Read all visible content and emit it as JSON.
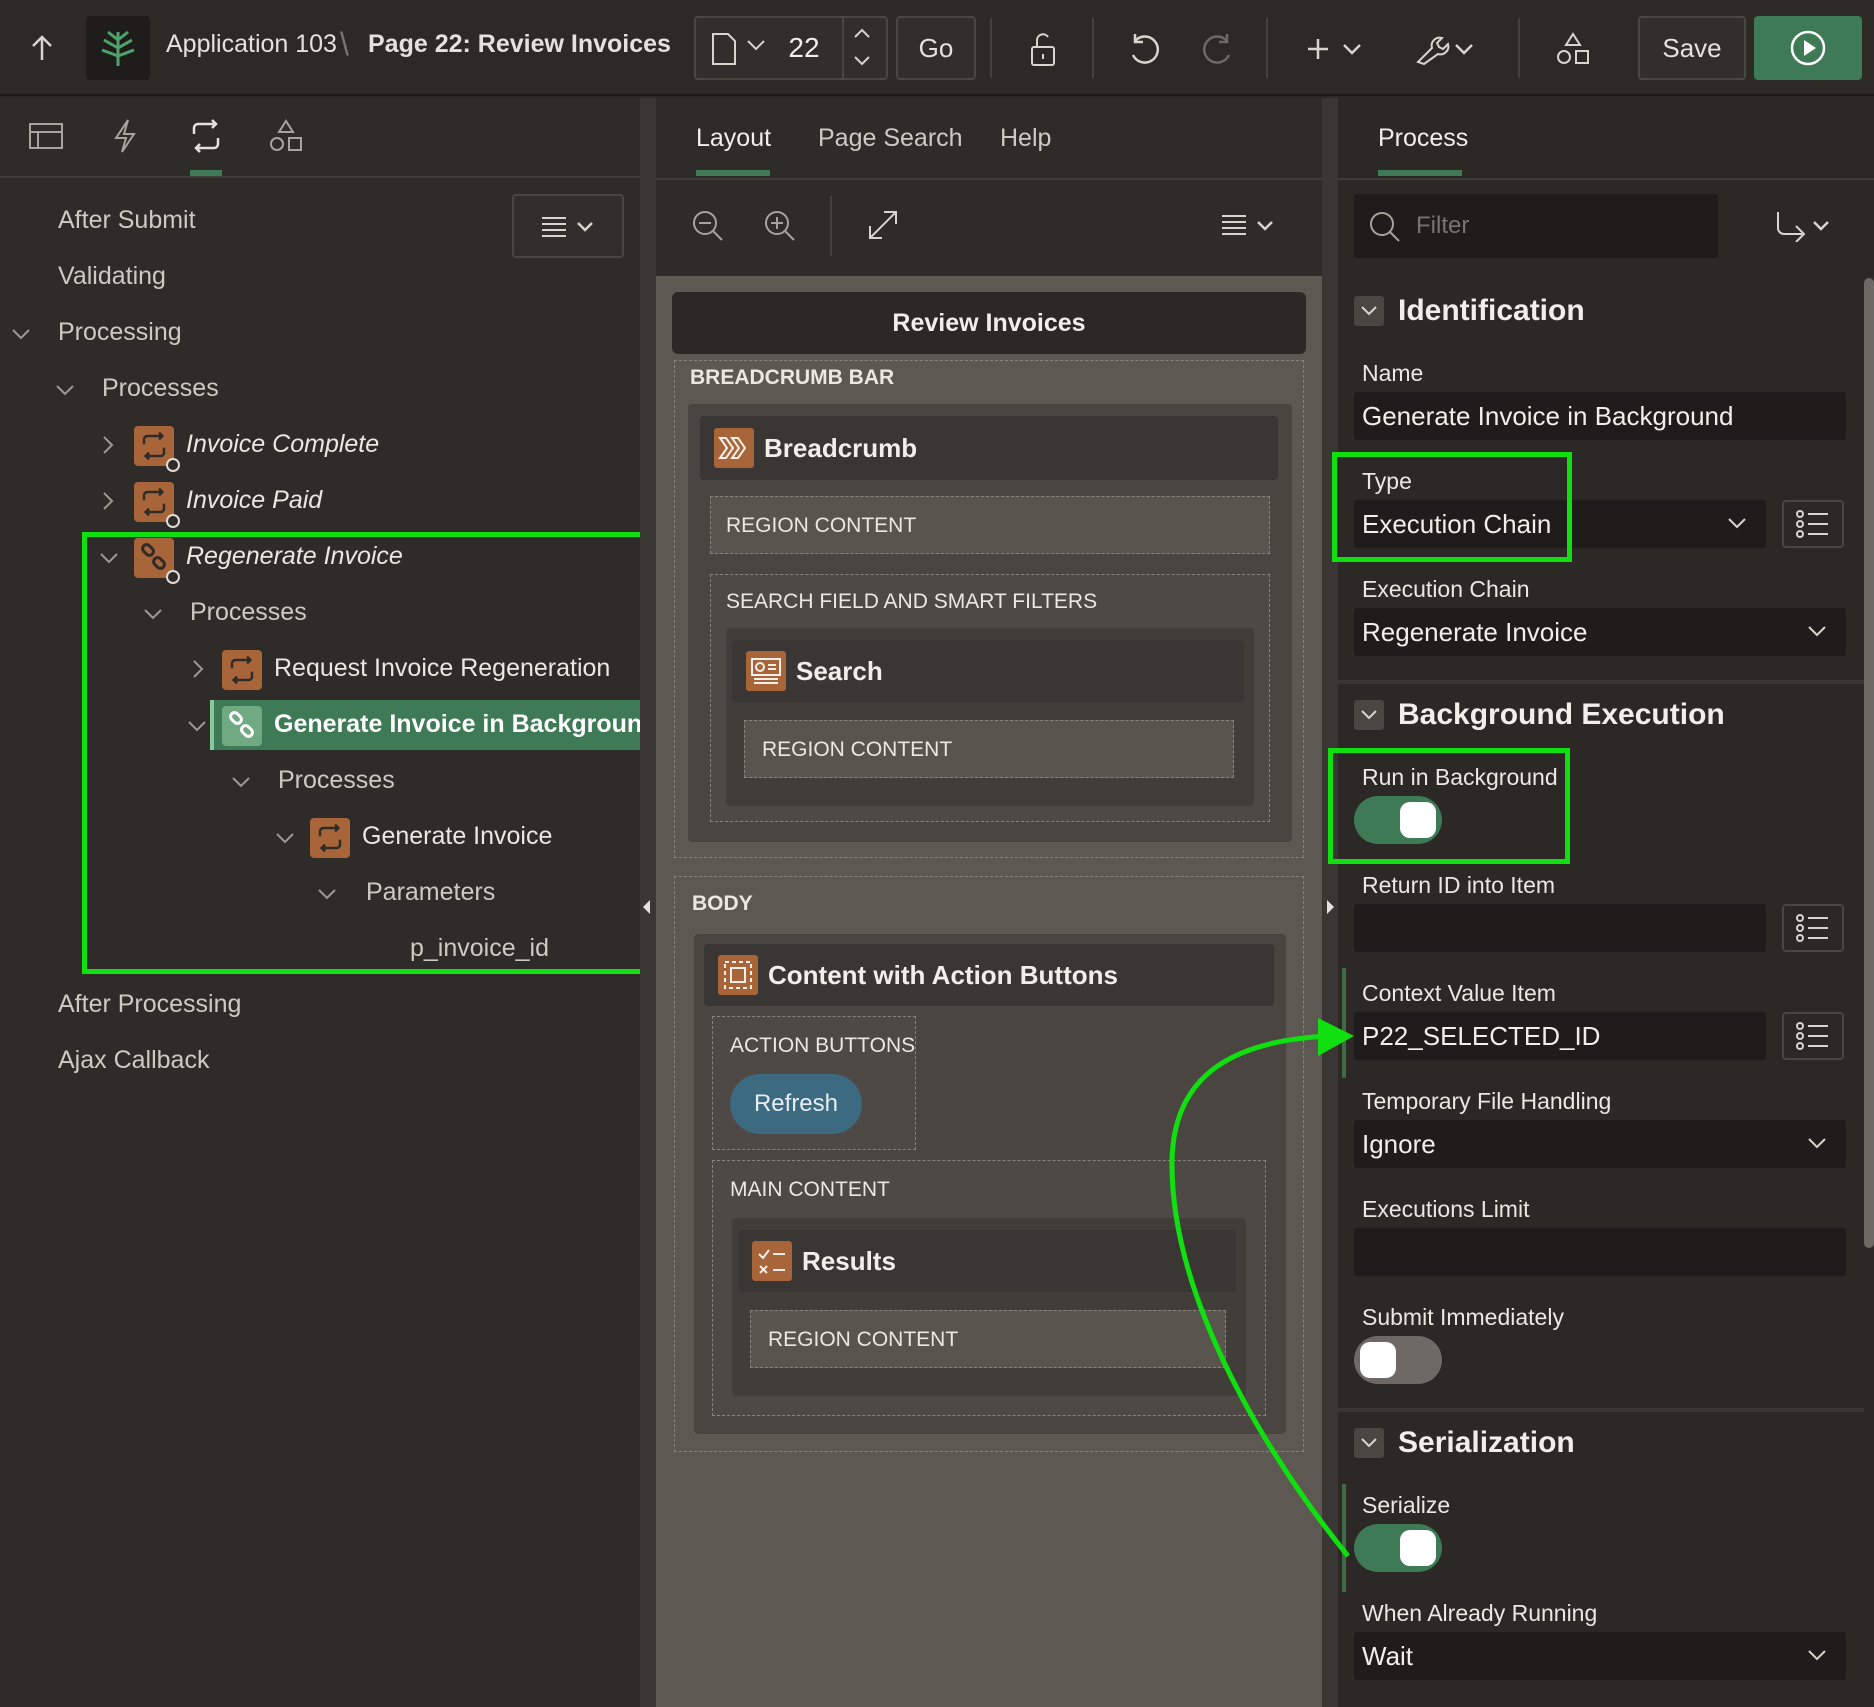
{
  "header": {
    "app_name": "Application 103",
    "separator": "\\",
    "page_title": "Page 22: Review Invoices",
    "page_number": "22",
    "go_label": "Go",
    "save_label": "Save"
  },
  "left_panel": {
    "tree": {
      "after_submit": "After Submit",
      "validating": "Validating",
      "processing": "Processing",
      "processes": "Processes",
      "invoice_complete": "Invoice Complete",
      "invoice_paid": "Invoice Paid",
      "regenerate_invoice": "Regenerate Invoice",
      "processes_2": "Processes",
      "request_regen": "Request Invoice Regeneration",
      "generate_bg": "Generate Invoice in Background",
      "processes_3": "Processes",
      "generate_invoice": "Generate Invoice",
      "parameters": "Parameters",
      "p_invoice_id": "p_invoice_id",
      "after_processing": "After Processing",
      "ajax_callback": "Ajax Callback"
    }
  },
  "center_panel": {
    "tabs": [
      "Layout",
      "Page Search",
      "Help"
    ],
    "page_name": "Review Invoices",
    "breadcrumb_bar": "BREADCRUMB BAR",
    "breadcrumb_region": "Breadcrumb",
    "region_content": "REGION CONTENT",
    "search_slot": "SEARCH FIELD AND SMART FILTERS",
    "search_region": "Search",
    "body_label": "BODY",
    "content_region": "Content with Action Buttons",
    "action_buttons": "ACTION BUTTONS",
    "refresh_label": "Refresh",
    "main_content": "MAIN CONTENT",
    "results_region": "Results"
  },
  "right_panel": {
    "tab": "Process",
    "filter_placeholder": "Filter",
    "identification": "Identification",
    "name_label": "Name",
    "name_value": "Generate Invoice in Background",
    "type_label": "Type",
    "type_value": "Execution Chain",
    "exec_chain_label": "Execution Chain",
    "exec_chain_value": "Regenerate Invoice",
    "background_execution": "Background Execution",
    "run_in_bg_label": "Run in Background",
    "run_in_bg_on": true,
    "return_id_label": "Return ID into Item",
    "return_id_value": "",
    "context_value_label": "Context Value Item",
    "context_value_value": "P22_SELECTED_ID",
    "temp_file_label": "Temporary File Handling",
    "temp_file_value": "Ignore",
    "exec_limit_label": "Executions Limit",
    "exec_limit_value": "",
    "submit_immediately_label": "Submit Immediately",
    "submit_immediately_on": false,
    "serialization": "Serialization",
    "serialize_label": "Serialize",
    "serialize_on": true,
    "when_running_label": "When Already Running",
    "when_running_value": "Wait"
  },
  "colors": {
    "accent_green": "#3e7a55",
    "highlight": "#10e010",
    "process_icon": "#a8653a",
    "run_button": "#3e7a55",
    "refresh_button": "#3c6a80"
  }
}
